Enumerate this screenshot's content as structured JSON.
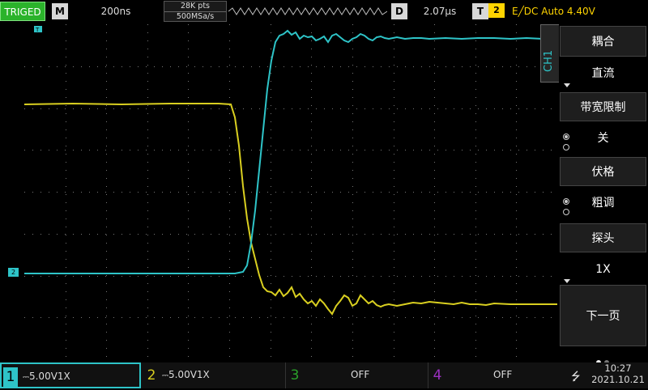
{
  "topbar": {
    "trigger_status": "TRIGED",
    "mode_key": "M",
    "timebase": "200ns",
    "memory_depth": "28K pts",
    "sample_rate": "500MSa/s",
    "delay_key": "D",
    "delay": "2.07μs",
    "trigger_key": "T",
    "trigger_channel": "2",
    "trigger_info": "E╱DC Auto 4.40V"
  },
  "markers": {
    "trigger_level_marker": "T",
    "ch2_ground_marker": "2"
  },
  "side_menu": {
    "channel_tab": "CH1",
    "coupling_label": "耦合",
    "coupling_value": "直流",
    "bandwidth_label": "带宽限制",
    "bandwidth_value": "关",
    "volts_div_label": "伏格",
    "volts_div_value": "粗调",
    "probe_label": "探头",
    "probe_value": "1X",
    "next_page_label": "下一页"
  },
  "bottom_bar": {
    "ch1": {
      "num": "1",
      "value": "5.00V",
      "probe": "1X"
    },
    "ch2": {
      "num": "2",
      "value": "5.00V",
      "probe": "1X"
    },
    "ch3": {
      "num": "3",
      "value": "OFF"
    },
    "ch4": {
      "num": "4",
      "value": "OFF"
    },
    "time": "10:27",
    "date": "2021.10.21"
  },
  "colors": {
    "ch1": "#2ec4c8",
    "ch2": "#d9cf20",
    "ch3": "#2aa02a",
    "ch4": "#9b30c0",
    "triged": "#2bb32b"
  },
  "icons": [
    "usb-icon",
    "dc-coupling-icon",
    "down-arrow-icon"
  ]
}
